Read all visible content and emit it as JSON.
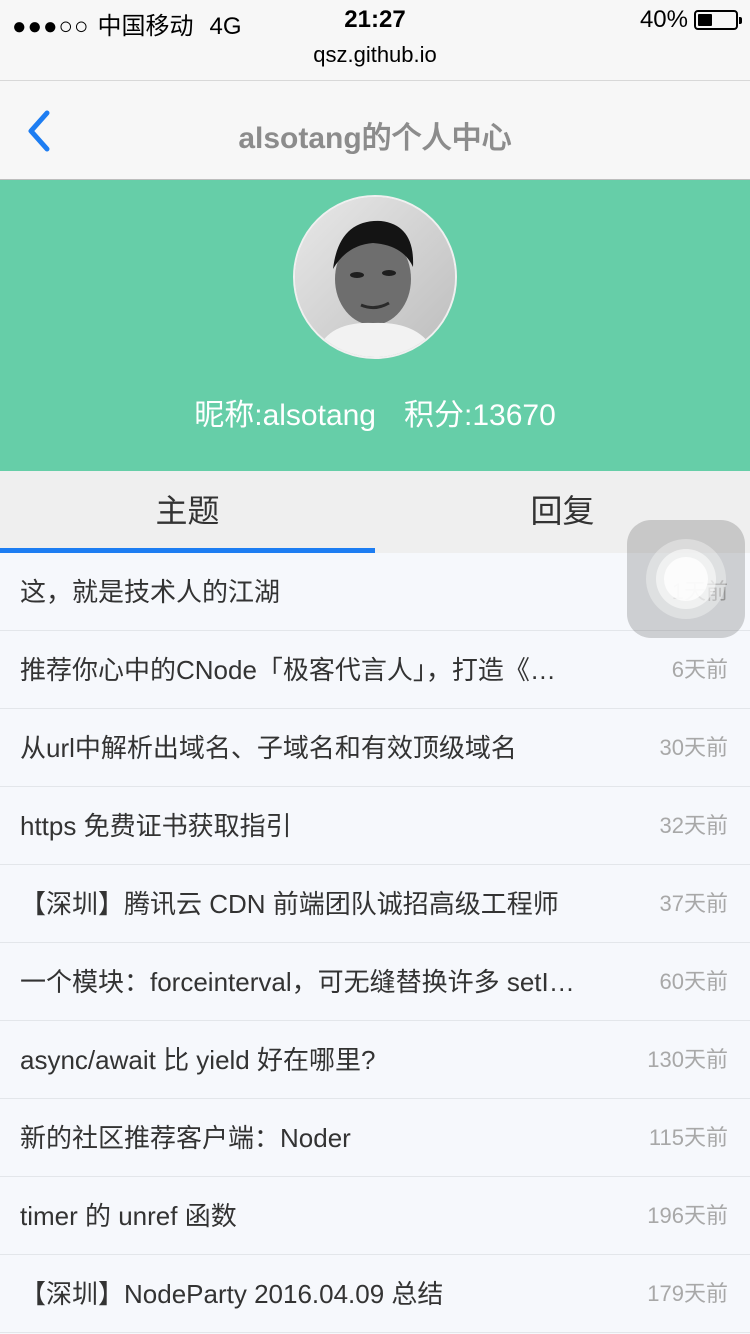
{
  "status_bar": {
    "signal": "●●●○○",
    "carrier": "中国移动",
    "network": "4G",
    "time": "21:27",
    "battery_text": "40%",
    "battery_level": 0.4,
    "url": "qsz.github.io"
  },
  "nav": {
    "title": "alsotang的个人中心",
    "back_icon": "chevron-left-icon",
    "accent_color": "#1d7df2"
  },
  "profile": {
    "nickname_text": "昵称:alsotang",
    "score_text": "积分:13670",
    "background_color": "#66cea8"
  },
  "tabs": [
    {
      "label": "主题",
      "active": true
    },
    {
      "label": "回复",
      "active": false
    }
  ],
  "topics": [
    {
      "title": "这，就是技术人的江湖",
      "time": "1天前"
    },
    {
      "title": "推荐你心中的CNode「极客代言人」，打造《…",
      "time": "6天前"
    },
    {
      "title": "从url中解析出域名、子域名和有效顶级域名",
      "time": "30天前"
    },
    {
      "title": "https 免费证书获取指引",
      "time": "32天前"
    },
    {
      "title": "【深圳】腾讯云 CDN 前端团队诚招高级工程师",
      "time": "37天前"
    },
    {
      "title": "一个模块：forceinterval，可无缝替换许多 setI…",
      "time": "60天前"
    },
    {
      "title": "async/await 比 yield 好在哪里?",
      "time": "130天前"
    },
    {
      "title": "新的社区推荐客户端：Noder",
      "time": "115天前"
    },
    {
      "title": "timer 的 unref 函数",
      "time": "196天前"
    },
    {
      "title": "【深圳】NodeParty 2016.04.09 总结",
      "time": "179天前"
    }
  ]
}
